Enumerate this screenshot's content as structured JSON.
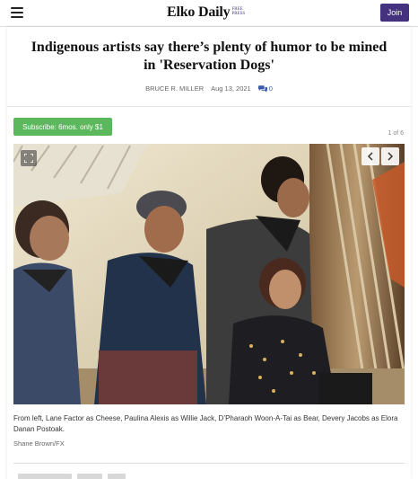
{
  "header": {
    "logo_text": "Elko Daily",
    "logo_subtext": "Free Press",
    "join_label": "Join",
    "menu_icon": "hamburger-icon"
  },
  "article": {
    "headline": "Indigenous artists say there’s plenty of humor to be mined in 'Reservation Dogs'",
    "author": "BRUCE R. MILLER",
    "date": "Aug 13, 2021",
    "comment_count": "0",
    "comment_icon": "comments-icon"
  },
  "promo": {
    "subscribe_label": "Subscribe: 6mos. only $1"
  },
  "gallery": {
    "counter": "1 of 6",
    "expand_icon": "expand-icon",
    "prev_icon": "chevron-left-icon",
    "next_icon": "chevron-right-icon",
    "caption": "From left, Lane Factor as Cheese, Paulina Alexis as Willie Jack, D’Pharaoh Woon-A-Tai as Bear, Devery Jacobs as Elora Danan Postoak.",
    "credit": "Shane Brown/FX"
  },
  "colors": {
    "join_bg": "#45327e",
    "subscribe_bg": "#5cb85c",
    "comment_accent": "#3b5ba9"
  }
}
